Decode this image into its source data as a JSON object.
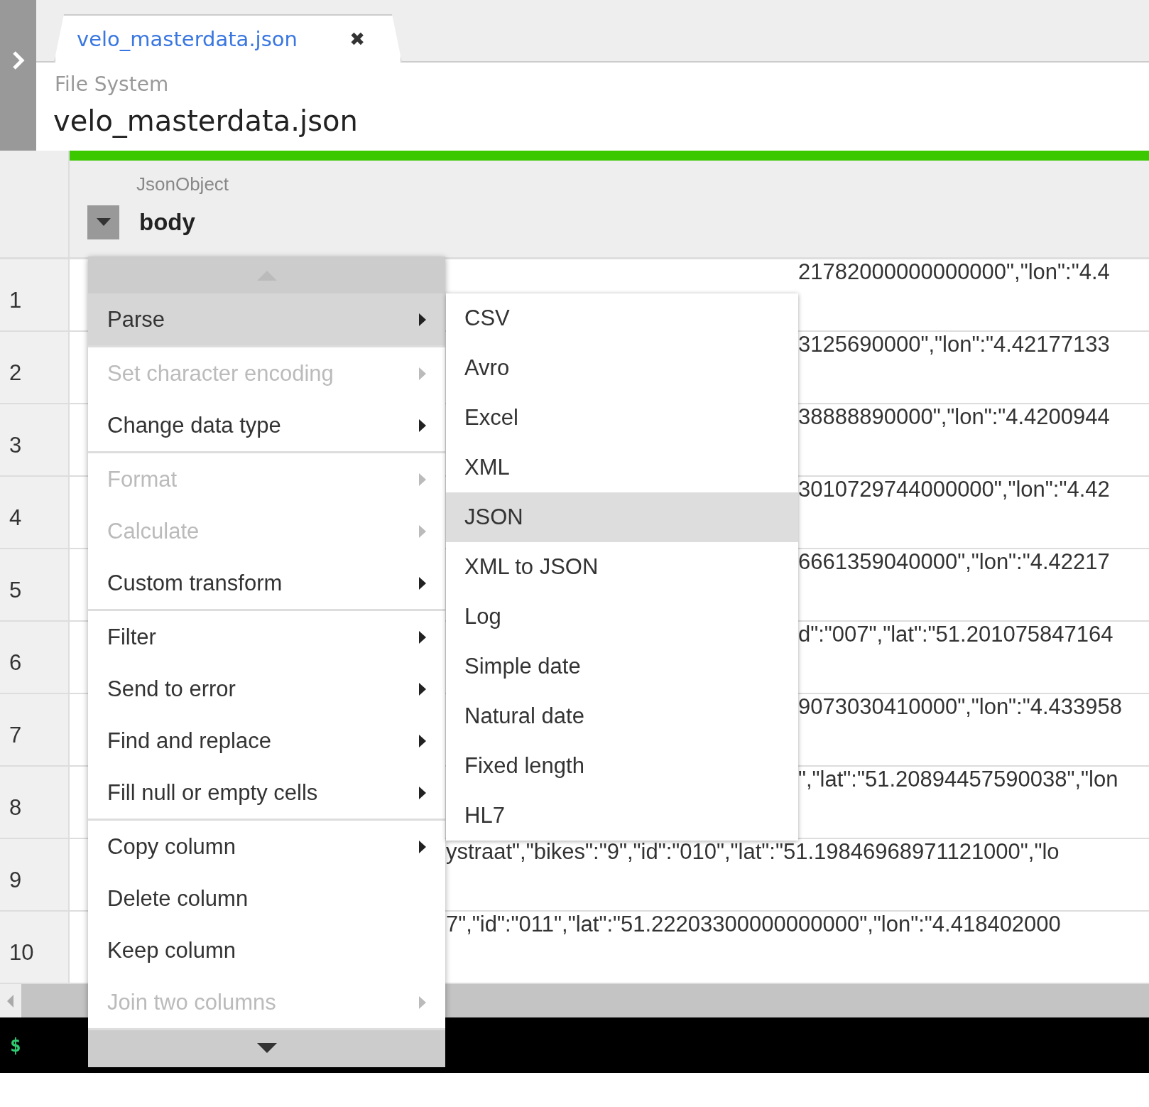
{
  "tab": {
    "label": "velo_masterdata.json",
    "close": "✖"
  },
  "source": "File System",
  "title": "velo_masterdata.json",
  "progress": {
    "level": 1
  },
  "column": {
    "type": "JsonObject",
    "name": "body"
  },
  "rows": [
    {
      "number": "1",
      "value": "21782000000000000\",\"lon\":\"4.4"
    },
    {
      "number": "2",
      "value": "3125690000\",\"lon\":\"4.42177133"
    },
    {
      "number": "3",
      "value": "38888890000\",\"lon\":\"4.4200944"
    },
    {
      "number": "4",
      "value": "3010729744000000\",\"lon\":\"4.42"
    },
    {
      "number": "5",
      "value": "6661359040000\",\"lon\":\"4.42217"
    },
    {
      "number": "6",
      "value": "d\":\"007\",\"lat\":\"51.201075847164"
    },
    {
      "number": "7",
      "value": "9073030410000\",\"lon\":\"4.433958"
    },
    {
      "number": "8",
      "value": "\",\"lat\":\"51.20894457590038\",\"lon"
    },
    {
      "number": "9",
      "value": "ystraat\",\"bikes\":\"9\",\"id\":\"010\",\"lat\":\"51.19846968971121000\",\"lo"
    },
    {
      "number": "10",
      "value": "7\",\"id\":\"011\",\"lat\":\"51.22203300000000000\",\"lon\":\"4.418402000"
    }
  ],
  "terminal": {
    "prompt": "$"
  },
  "menu": {
    "groups": [
      [
        {
          "label": "Parse",
          "selected": true,
          "disabled": false,
          "submenu": true
        }
      ],
      [
        {
          "label": "Set character encoding",
          "selected": false,
          "disabled": true,
          "submenu": true
        },
        {
          "label": "Change data type",
          "selected": false,
          "disabled": false,
          "submenu": true
        }
      ],
      [
        {
          "label": "Format",
          "selected": false,
          "disabled": true,
          "submenu": true
        },
        {
          "label": "Calculate",
          "selected": false,
          "disabled": true,
          "submenu": true
        },
        {
          "label": "Custom transform",
          "selected": false,
          "disabled": false,
          "submenu": true
        }
      ],
      [
        {
          "label": "Filter",
          "selected": false,
          "disabled": false,
          "submenu": true
        },
        {
          "label": "Send to error",
          "selected": false,
          "disabled": false,
          "submenu": true
        },
        {
          "label": "Find and replace",
          "selected": false,
          "disabled": false,
          "submenu": true
        },
        {
          "label": "Fill null or empty cells",
          "selected": false,
          "disabled": false,
          "submenu": true
        }
      ],
      [
        {
          "label": "Copy column",
          "selected": false,
          "disabled": false,
          "submenu": true
        },
        {
          "label": "Delete column",
          "selected": false,
          "disabled": false,
          "submenu": false
        },
        {
          "label": "Keep column",
          "selected": false,
          "disabled": false,
          "submenu": false
        },
        {
          "label": "Join two columns",
          "selected": false,
          "disabled": true,
          "submenu": true
        }
      ]
    ]
  },
  "submenu": {
    "items": [
      {
        "label": "CSV",
        "selected": false
      },
      {
        "label": "Avro",
        "selected": false
      },
      {
        "label": "Excel",
        "selected": false
      },
      {
        "label": "XML",
        "selected": false
      },
      {
        "label": "JSON",
        "selected": true
      },
      {
        "label": "XML to JSON",
        "selected": false
      },
      {
        "label": "Log",
        "selected": false
      },
      {
        "label": "Simple date",
        "selected": false
      },
      {
        "label": "Natural date",
        "selected": false
      },
      {
        "label": "Fixed length",
        "selected": false
      },
      {
        "label": "HL7",
        "selected": false
      }
    ]
  }
}
